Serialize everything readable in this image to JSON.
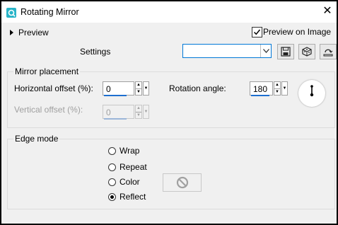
{
  "window": {
    "title": "Rotating Mirror",
    "close_glyph": "✕"
  },
  "preview": {
    "label": "Preview",
    "preview_on_image_label": "Preview on Image",
    "preview_on_image_checked": true
  },
  "settings": {
    "label": "Settings",
    "value": ""
  },
  "mirror_placement": {
    "title": "Mirror placement",
    "horizontal_offset_label": "Horizontal offset (%):",
    "horizontal_offset_value": "0",
    "vertical_offset_label": "Vertical offset (%):",
    "vertical_offset_value": "0",
    "rotation_angle_label": "Rotation angle:",
    "rotation_angle_value": "180"
  },
  "edge_mode": {
    "title": "Edge mode",
    "options": [
      {
        "label": "Wrap",
        "selected": false
      },
      {
        "label": "Repeat",
        "selected": false
      },
      {
        "label": "Color",
        "selected": false
      },
      {
        "label": "Reflect",
        "selected": true
      }
    ]
  },
  "icons": [
    "app-icon",
    "expand-triangle-icon",
    "checkmark-icon",
    "chevron-down-icon",
    "save-icon",
    "random-icon",
    "reset-icon",
    "angle-dial-icon",
    "no-symbol-icon"
  ],
  "colors": {
    "accent": "#1e6fd0",
    "app_icon": "#28b4c8"
  }
}
